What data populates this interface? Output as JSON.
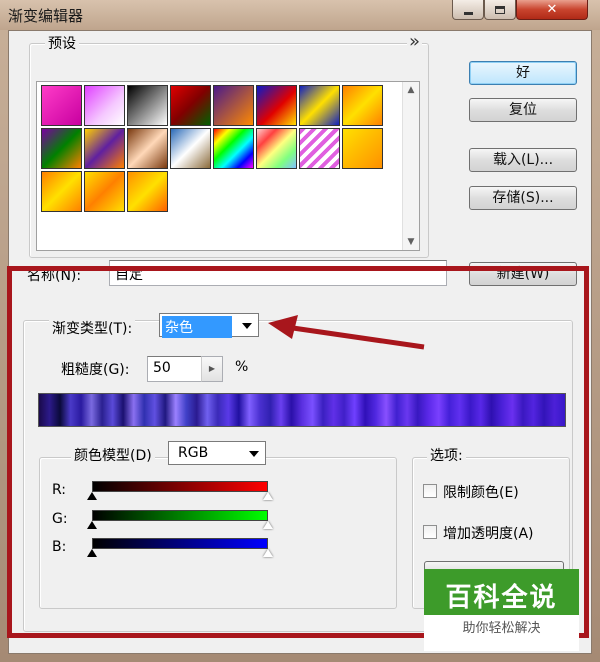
{
  "window": {
    "title": "渐变编辑器",
    "close_symbol": "✕"
  },
  "presets": {
    "label": "预设",
    "menu_arrow": "»",
    "swatches": [
      "magenta-gradient",
      "violet-transparent",
      "black-white",
      "red-green",
      "violet-orange",
      "blue-red-yellow",
      "blue-yellow-blue",
      "orange-yellow-orange",
      "violet-green-orange",
      "yellow-violet-orange",
      "copper",
      "chrome",
      "spectrum",
      "transparent-rainbow",
      "transparent-stripes",
      "yellow-orange",
      "orange-yellow",
      "yellow-orange-2",
      "orange-yellow-2"
    ]
  },
  "buttons": {
    "ok": "好",
    "reset": "复位",
    "load": "载入(L)...",
    "save": "存储(S)...",
    "new": "新建(W)"
  },
  "name_field": {
    "label": "名称(N):",
    "value": "自定"
  },
  "gradient": {
    "type_label": "渐变类型(T):",
    "type_value": "杂色",
    "roughness_label": "粗糙度(G):",
    "roughness_value": "50",
    "roughness_unit": "%"
  },
  "color_model": {
    "label": "颜色模型(D)",
    "value": "RGB",
    "channels": [
      {
        "label": "R:",
        "color": "#ff0000"
      },
      {
        "label": "G:",
        "color": "#00ff00"
      },
      {
        "label": "B:",
        "color": "#0000ff"
      }
    ]
  },
  "options": {
    "label": "选项:",
    "restrict_colors": "限制颜色(E)",
    "add_transparency": "增加透明度(A)"
  },
  "watermark": {
    "line1": "百科全说",
    "line2": "助你轻松解决"
  },
  "colors": {
    "highlight": "#a8161c",
    "arrow": "#a8161c"
  }
}
